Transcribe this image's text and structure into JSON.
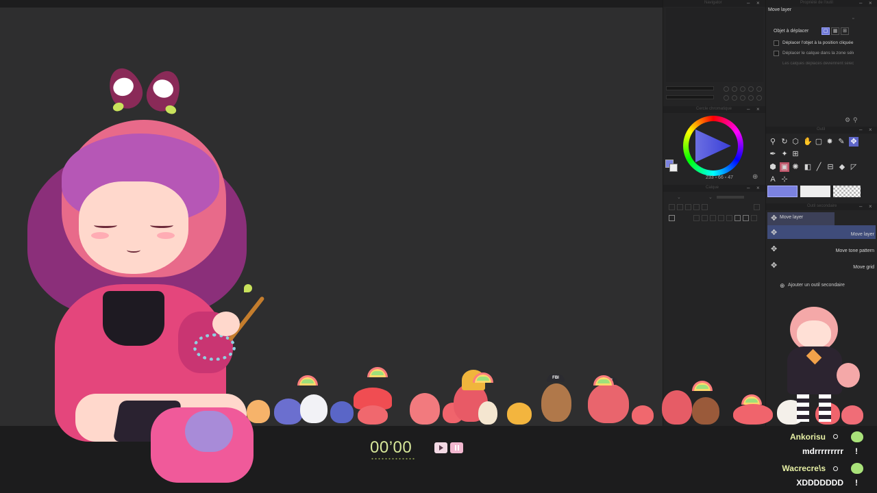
{
  "app": {
    "panels": {
      "navigator_title": "Navigator",
      "color_title": "Cercle chromatique",
      "layer_title": "Calque",
      "tool_property_title": "Propriété de l'outil",
      "tool_title": "Outil",
      "subtool_title": "Outil secondaire"
    }
  },
  "tool_property": {
    "header": "Move layer",
    "object_label": "Objet à déplacer",
    "option1": "Déplacer l'objet à la position cliquée",
    "option2": "Déplacer le calque dans la zone sélectionnée",
    "note": "Les calques déplacés deviennent sélectionnés"
  },
  "color_wheel": {
    "hsv_values": "233 ▫ 66 ▫ 47",
    "main_color": "#7b82e0",
    "sub_color": "#eeeeee"
  },
  "subtool": {
    "active_tab": "Move layer",
    "items": [
      {
        "label": "Move layer",
        "icon": "move-cross-icon"
      },
      {
        "label": "Move tone pattern",
        "icon": "move-cross-icon"
      },
      {
        "label": "Move grid",
        "icon": "move-cross-icon"
      }
    ],
    "add_secondary": "Ajouter un outil secondaire"
  },
  "color_chips": [
    "#7b82e0",
    "#eeeeee",
    "transparent"
  ],
  "stream": {
    "timer": "00’00",
    "accent": "#d7e79a"
  },
  "chat": [
    {
      "user": "Ankorisu",
      "message": "mdrrrrrrrrr"
    },
    {
      "user": "Wacrecre\\s",
      "message": "XDDDDDDD"
    }
  ]
}
